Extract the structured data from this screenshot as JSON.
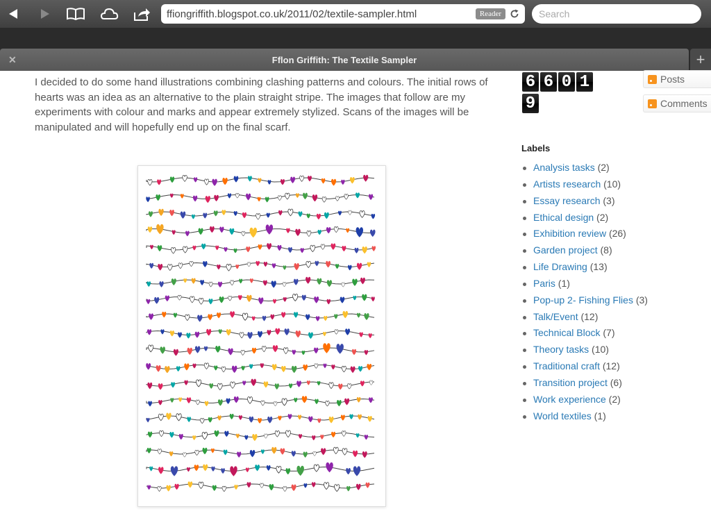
{
  "browser": {
    "url": "ffiongriffith.blogspot.co.uk/2011/02/textile-sampler.html",
    "reader_label": "Reader",
    "search_placeholder": "Search",
    "tab_title": "Fflon Griffith: The Textile Sampler"
  },
  "post": {
    "paragraph": "I decided to do some hand illustrations combining clashing patterns and colours. The initial rows of hearts was an idea as an alternative to the plain straight stripe. The images that follow are my experiments with colour and marks and appear extremely stylized. Scans of the images will be manipulated and will hopefully end up on the final scarf."
  },
  "sidebar": {
    "counter_row1": [
      "6",
      "6",
      "0",
      "1"
    ],
    "counter_row2": [
      "9"
    ],
    "feeds": {
      "posts": "Posts",
      "comments": "Comments"
    },
    "labels_title": "Labels",
    "labels": [
      {
        "name": "Analysis tasks",
        "count": "(2)"
      },
      {
        "name": "Artists research",
        "count": "(10)"
      },
      {
        "name": "Essay research",
        "count": "(3)"
      },
      {
        "name": "Ethical design",
        "count": "(2)"
      },
      {
        "name": "Exhibition review",
        "count": "(26)"
      },
      {
        "name": "Garden project",
        "count": "(8)"
      },
      {
        "name": "Life Drawing",
        "count": "(13)"
      },
      {
        "name": "Paris",
        "count": "(1)"
      },
      {
        "name": "Pop-up 2- Fishing Flies",
        "count": "(3)"
      },
      {
        "name": "Talk/Event",
        "count": "(12)"
      },
      {
        "name": "Technical Block",
        "count": "(7)"
      },
      {
        "name": "Theory tasks",
        "count": "(10)"
      },
      {
        "name": "Traditional craft",
        "count": "(12)"
      },
      {
        "name": "Transition project",
        "count": "(6)"
      },
      {
        "name": "Work experience",
        "count": "(2)"
      },
      {
        "name": "World textiles",
        "count": "(1)"
      }
    ]
  },
  "icons": {
    "back": "back-icon",
    "forward": "forward-icon",
    "bookmarks": "bookmarks-icon",
    "cloud": "icloud-tabs-icon",
    "share": "share-icon",
    "reload": "reload-icon",
    "close": "close-tab-icon",
    "new_tab": "new-tab-icon",
    "rss": "rss-icon"
  },
  "colors": {
    "link": "#2a7ab5",
    "heart_palette": [
      "#e0245e",
      "#8e24aa",
      "#1e3ea8",
      "#2e9e3e",
      "#f5a623",
      "#ff6f00",
      "#00a6a6",
      "#c2185b",
      "#43a047",
      "#3949ab",
      "#ef5350",
      "#fbc02d"
    ]
  }
}
